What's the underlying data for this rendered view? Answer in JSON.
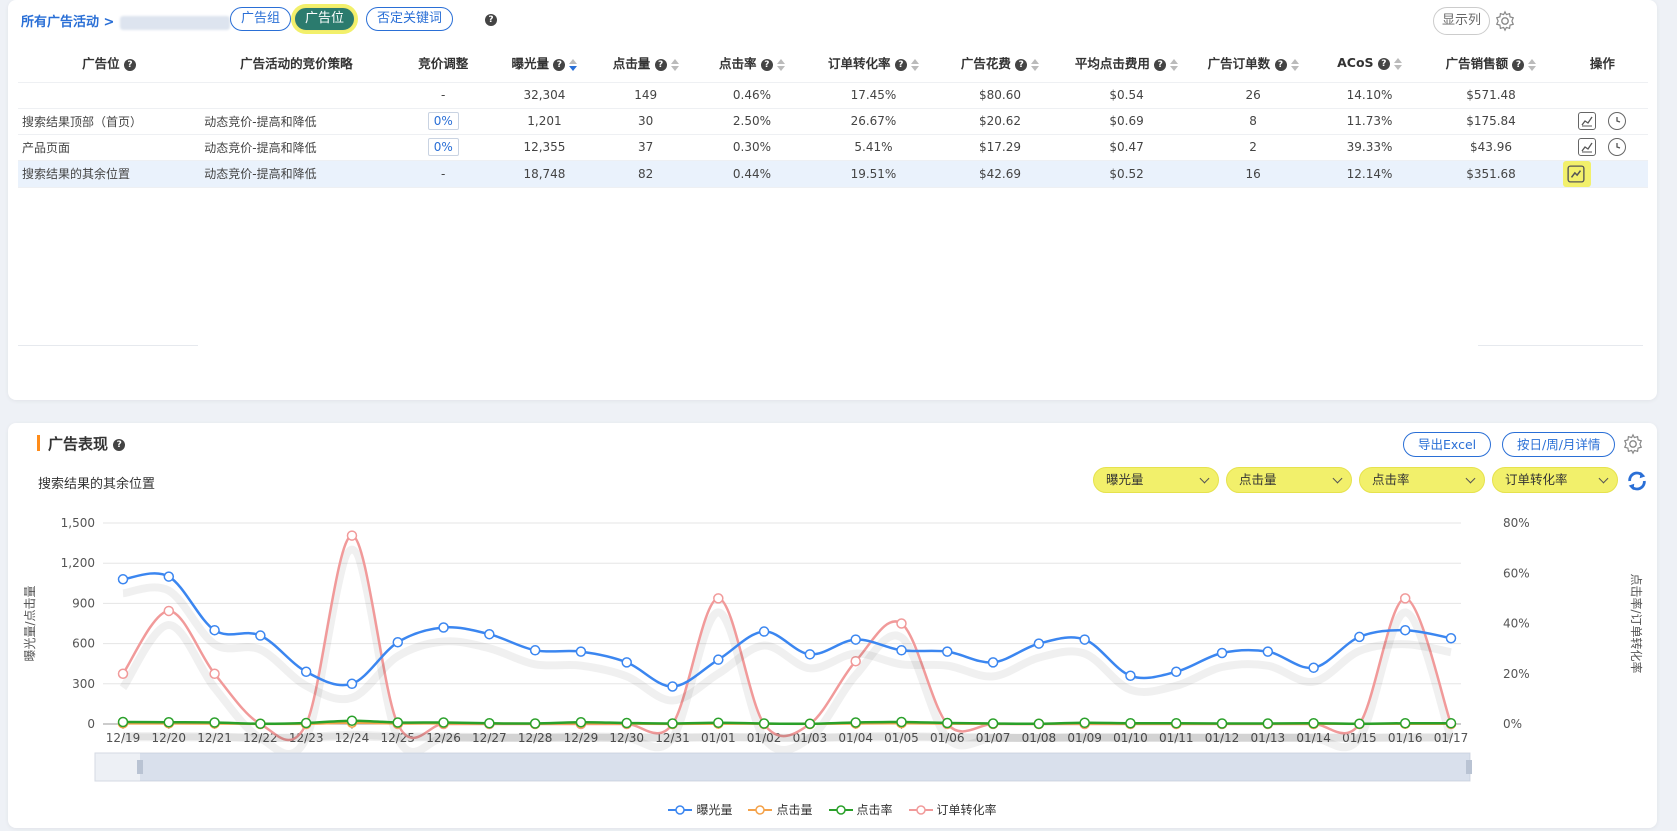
{
  "nav": {
    "breadcrumb": "所有广告活动 >",
    "tabs": [
      "广告组",
      "广告位",
      "否定关键词"
    ],
    "active_tab": 1,
    "show_columns": "显示列"
  },
  "table": {
    "headers": [
      "广告位",
      "广告活动的竞价策略",
      "竞价调整",
      "曝光量",
      "点击量",
      "点击率",
      "订单转化率",
      "广告花费",
      "平均点击费用",
      "广告订单数",
      "ACoS",
      "广告销售额",
      "操作"
    ],
    "summary": [
      "",
      "",
      "-",
      "32,304",
      "149",
      "0.46%",
      "17.45%",
      "$80.60",
      "$0.54",
      "26",
      "14.10%",
      "$571.48"
    ],
    "rows": [
      [
        "搜索结果顶部（首页）",
        "动态竞价-提高和降低",
        "0%",
        "1,201",
        "30",
        "2.50%",
        "26.67%",
        "$20.62",
        "$0.69",
        "8",
        "11.73%",
        "$175.84"
      ],
      [
        "产品页面",
        "动态竞价-提高和降低",
        "0%",
        "12,355",
        "37",
        "0.30%",
        "5.41%",
        "$17.29",
        "$0.47",
        "2",
        "39.33%",
        "$43.96"
      ],
      [
        "搜索结果的其余位置",
        "动态竞价-提高和降低",
        "-",
        "18,748",
        "82",
        "0.44%",
        "19.51%",
        "$42.69",
        "$0.52",
        "16",
        "12.14%",
        "$351.68"
      ]
    ]
  },
  "perf": {
    "title": "广告表现",
    "export_label": "导出Excel",
    "detail_label": "按日/周/月详情",
    "subtitle": "搜索结果的其余位置",
    "selects": [
      "曝光量",
      "点击量",
      "点击率",
      "订单转化率"
    ]
  },
  "chart_data": {
    "type": "line",
    "x": [
      "12/19",
      "12/20",
      "12/21",
      "12/22",
      "12/23",
      "12/24",
      "12/25",
      "12/26",
      "12/27",
      "12/28",
      "12/29",
      "12/30",
      "12/31",
      "01/01",
      "01/02",
      "01/03",
      "01/04",
      "01/05",
      "01/06",
      "01/07",
      "01/08",
      "01/09",
      "01/10",
      "01/11",
      "01/12",
      "01/13",
      "01/14",
      "01/15",
      "01/16",
      "01/17"
    ],
    "ylabel": "曝光量/点击量",
    "y2label": "点击率/订单转化率",
    "ylim": [
      0,
      1500
    ],
    "y2lim": [
      0,
      80
    ],
    "yticks": [
      "0",
      "300",
      "600",
      "900",
      "1,200",
      "1,500"
    ],
    "y2ticks": [
      "0%",
      "20%",
      "40%",
      "60%",
      "80%"
    ],
    "grid": true,
    "legend_position": "bottom",
    "series": [
      {
        "name": "曝光量",
        "axis": "left",
        "color": "#3b86f0",
        "values": [
          1080,
          1100,
          700,
          660,
          390,
          300,
          610,
          720,
          670,
          550,
          540,
          460,
          280,
          480,
          690,
          520,
          630,
          550,
          540,
          460,
          600,
          630,
          360,
          390,
          530,
          540,
          420,
          650,
          700,
          640
        ]
      },
      {
        "name": "点击量",
        "axis": "left",
        "color": "#f4a24a",
        "values": [
          5,
          5,
          4,
          1,
          2,
          10,
          4,
          5,
          3,
          2,
          5,
          3,
          1,
          3,
          2,
          1,
          4,
          6,
          3,
          2,
          1,
          4,
          2,
          2,
          2,
          2,
          2,
          1,
          2,
          2
        ]
      },
      {
        "name": "点击率",
        "axis": "right",
        "color": "#2aa02a",
        "values": [
          0.8,
          0.7,
          0.6,
          0.1,
          0.4,
          1.3,
          0.6,
          0.6,
          0.3,
          0.2,
          0.7,
          0.4,
          0.2,
          0.5,
          0.2,
          0.1,
          0.6,
          0.8,
          0.4,
          0.2,
          0.1,
          0.5,
          0.3,
          0.3,
          0.2,
          0.2,
          0.3,
          0.1,
          0.3,
          0.3
        ]
      },
      {
        "name": "订单转化率",
        "axis": "right",
        "color": "#f19a9a",
        "values": [
          20,
          45,
          20,
          0,
          0,
          75,
          0,
          0,
          0,
          0,
          0,
          0,
          0,
          50,
          0,
          0,
          25,
          40,
          0,
          0,
          0,
          0,
          0,
          0,
          0,
          0,
          0,
          0,
          50,
          0
        ]
      }
    ]
  }
}
